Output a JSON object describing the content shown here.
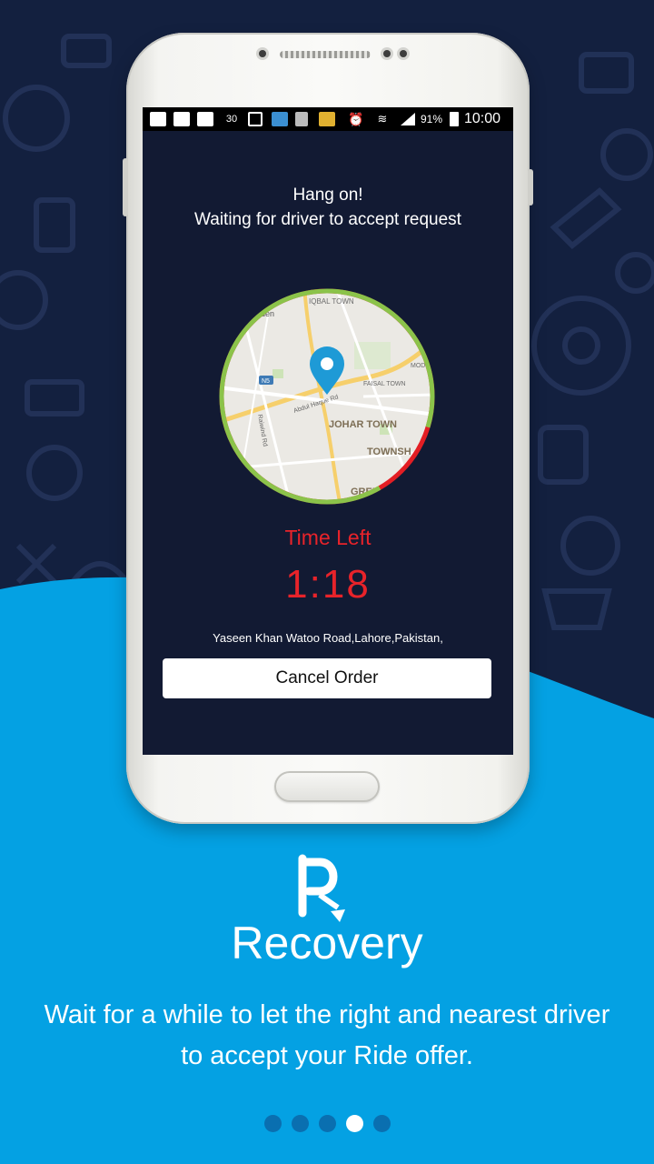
{
  "status_bar": {
    "battery": "91%",
    "time": "10:00",
    "notification_badge": "30"
  },
  "waiting": {
    "line1": "Hang on!",
    "line2": "Waiting for driver to accept request"
  },
  "map": {
    "labels": {
      "iqbal_town": "IQBAL TOWN",
      "garden": "rden",
      "faisal_town": "FAISAL TOWN",
      "model": "MODEL",
      "johar_town": "JOHAR TOWN",
      "township": "TOWNSH",
      "green": "GREE",
      "raiwind": "Raiwind Rd",
      "abdul_haque": "Abdul Haque Rd",
      "n5": "N5"
    },
    "timer_progress": 0.88,
    "ring_color_remaining": "#8bc34a",
    "ring_color_elapsed": "#e31e24"
  },
  "timer": {
    "label": "Time Left",
    "value": "1:18"
  },
  "address": "Yaseen Khan Watoo Road,Lahore,Pakistan,",
  "cancel_button": "Cancel Order",
  "brand": {
    "name": "Recovery",
    "icon": "recovery-r-logo"
  },
  "tagline": "Wait for a while to let the right and nearest driver to accept your Ride offer.",
  "pagination": {
    "count": 5,
    "active_index": 3
  },
  "colors": {
    "dark_bg": "#13203f",
    "blue_bg": "#04a1e3",
    "accent_red": "#e8232a",
    "pin_blue": "#1e9ad6"
  }
}
